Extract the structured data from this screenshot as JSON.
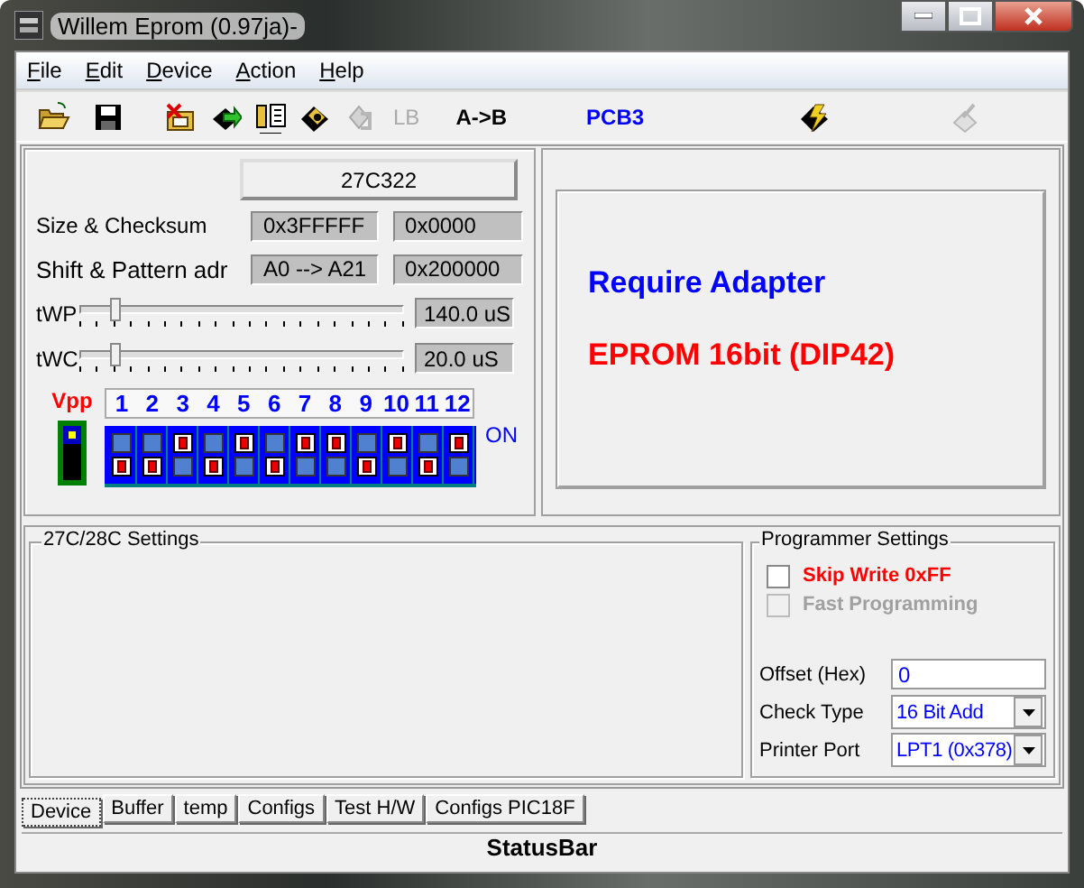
{
  "window": {
    "title": "Willem Eprom (0.97ja)-"
  },
  "menu": [
    {
      "label": "File"
    },
    {
      "label": "Edit"
    },
    {
      "label": "Device"
    },
    {
      "label": "Action"
    },
    {
      "label": "Help"
    }
  ],
  "toolbar": [
    {
      "kind": "icon",
      "disabled": false
    },
    {
      "kind": "icon",
      "disabled": false
    },
    {
      "kind": "icon",
      "disabled": false
    },
    {
      "kind": "icon",
      "disabled": false
    },
    {
      "kind": "icon",
      "disabled": false
    },
    {
      "kind": "icon",
      "disabled": false
    },
    {
      "kind": "icon",
      "disabled": true
    },
    {
      "kind": "text",
      "label": "LB",
      "disabled": true
    },
    {
      "kind": "text",
      "label": "A->B",
      "disabled": false,
      "color": "#000000"
    },
    {
      "kind": "text",
      "label": "PCB3",
      "disabled": false,
      "color": "#0000ff"
    },
    {
      "kind": "icon",
      "disabled": false
    },
    {
      "kind": "icon",
      "disabled": true
    }
  ],
  "device": {
    "name": "27C322",
    "rows": [
      {
        "label": "Size & Checksum",
        "values": [
          "0x3FFFFF",
          "0x0000"
        ]
      },
      {
        "label": "Shift & Pattern adr",
        "values": [
          "A0 --> A21",
          "0x200000"
        ]
      }
    ],
    "sliders": [
      {
        "label": "tWP",
        "level": 0.1,
        "reading": "140.0 uS"
      },
      {
        "label": "tWC",
        "level": 0.1,
        "reading": "20.0 uS"
      }
    ],
    "vpp": {
      "label": "Vpp"
    },
    "dip": {
      "on_label": "ON",
      "switches": [
        {
          "label": "1",
          "on": false
        },
        {
          "label": "2",
          "on": false
        },
        {
          "label": "3",
          "on": true
        },
        {
          "label": "4",
          "on": false
        },
        {
          "label": "5",
          "on": true
        },
        {
          "label": "6",
          "on": false
        },
        {
          "label": "7",
          "on": true
        },
        {
          "label": "8",
          "on": true
        },
        {
          "label": "9",
          "on": false
        },
        {
          "label": "10",
          "on": true
        },
        {
          "label": "11",
          "on": false
        },
        {
          "label": "12",
          "on": true
        }
      ]
    }
  },
  "adapter": {
    "heading": "Require Adapter",
    "package": "EPROM 16bit (DIP42)"
  },
  "settings": {
    "title": "27C/28C Settings"
  },
  "programmer": {
    "title": "Programmer Settings",
    "checkboxes": [
      {
        "label": "Skip Write 0xFF",
        "checked": false,
        "disabled": false
      },
      {
        "label": "Fast Programming",
        "checked": false,
        "disabled": true
      }
    ],
    "fields": [
      {
        "kind": "input",
        "label": "Offset (Hex)",
        "value": "0"
      },
      {
        "kind": "dropdown",
        "label": "Check Type",
        "value": "16 Bit Add"
      },
      {
        "kind": "dropdown",
        "label": "Printer Port",
        "value": "LPT1 (0x378)"
      }
    ]
  },
  "tabs": [
    {
      "label": "Device",
      "selected": true
    },
    {
      "label": "Buffer",
      "selected": false
    },
    {
      "label": "temp",
      "selected": false
    },
    {
      "label": "Configs",
      "selected": false
    },
    {
      "label": "Test H/W",
      "selected": false
    },
    {
      "label": "Configs PIC18F",
      "selected": false
    }
  ],
  "status_bar": {
    "text": "StatusBar"
  }
}
